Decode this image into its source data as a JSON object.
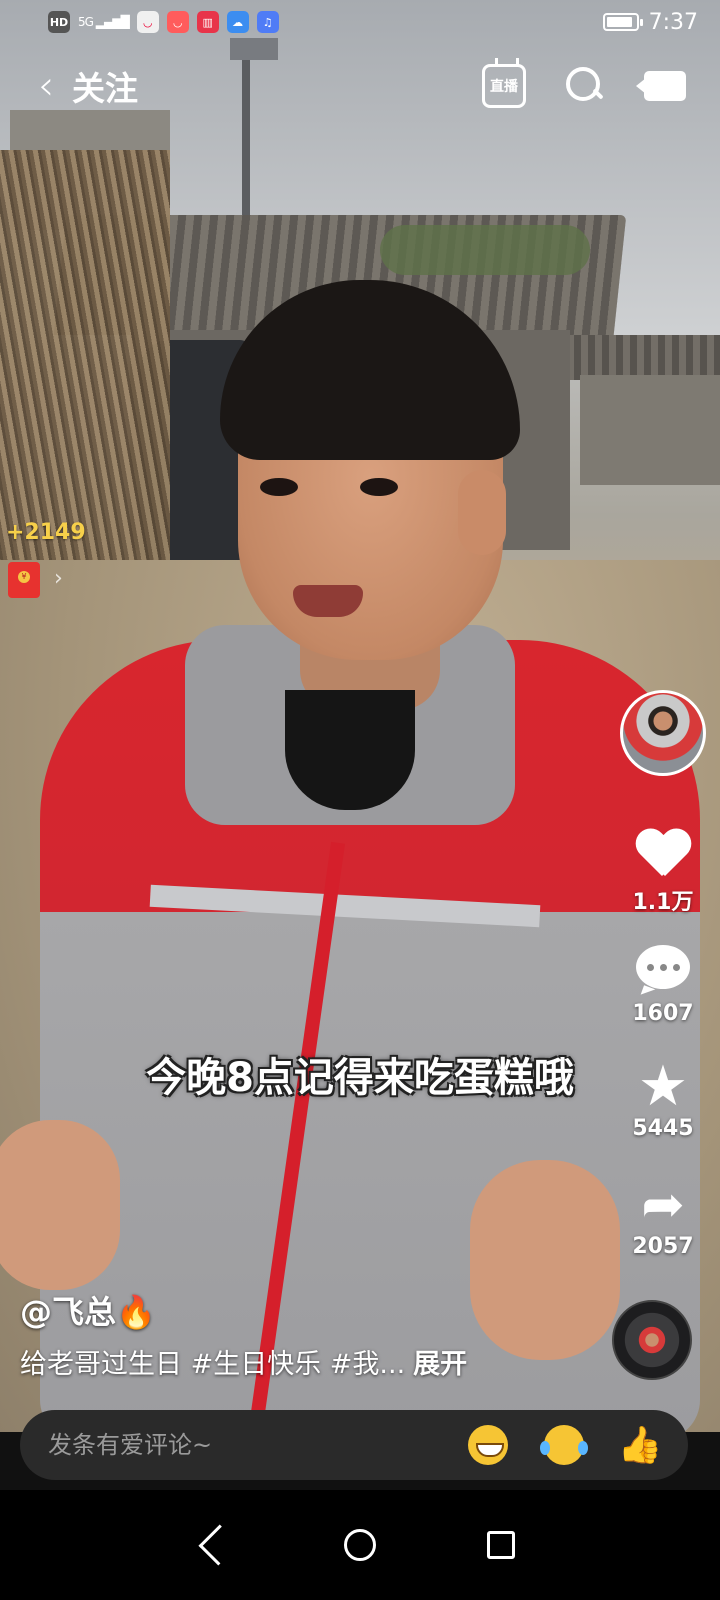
{
  "status_bar": {
    "hd": "HD",
    "network": "5G",
    "time": "7:37",
    "battery_level": 0.9
  },
  "nav": {
    "title": "关注",
    "live_label": "直播"
  },
  "coins": {
    "count": "+2149"
  },
  "rail": {
    "likes": "1.1万",
    "comments": "1607",
    "favorites": "5445",
    "shares": "2057"
  },
  "video": {
    "subtitle": "今晚8点记得来吃蛋糕哦",
    "author": "@飞总🔥",
    "caption": "给老哥过生日 #生日快乐 #我...",
    "expand_label": "展开"
  },
  "comment_bar": {
    "placeholder": "发条有爱评论~"
  },
  "colors": {
    "coin_gold": "#f7d04a",
    "red_envelope": "#e7322f",
    "comment_bg": "#2a2a2a"
  },
  "icons": {
    "back": "chevron-left-icon",
    "search": "search-icon",
    "camera": "camera-icon",
    "like": "heart-icon",
    "comment": "comment-bubble-icon",
    "favorite": "star-icon",
    "share": "share-arrow-icon",
    "emoji_grin": "grinning-emoji-icon",
    "emoji_cry": "laughing-tears-emoji-icon",
    "emoji_thumb": "thumbs-up-emoji-icon"
  }
}
